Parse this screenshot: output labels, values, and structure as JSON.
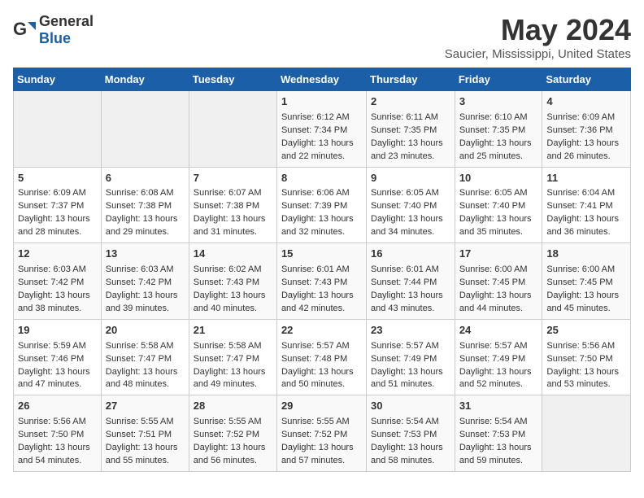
{
  "header": {
    "logo_general": "General",
    "logo_blue": "Blue",
    "title": "May 2024",
    "subtitle": "Saucier, Mississippi, United States"
  },
  "days_of_week": [
    "Sunday",
    "Monday",
    "Tuesday",
    "Wednesday",
    "Thursday",
    "Friday",
    "Saturday"
  ],
  "weeks": [
    [
      {
        "day": "",
        "content": ""
      },
      {
        "day": "",
        "content": ""
      },
      {
        "day": "",
        "content": ""
      },
      {
        "day": "1",
        "content": "Sunrise: 6:12 AM\nSunset: 7:34 PM\nDaylight: 13 hours and 22 minutes."
      },
      {
        "day": "2",
        "content": "Sunrise: 6:11 AM\nSunset: 7:35 PM\nDaylight: 13 hours and 23 minutes."
      },
      {
        "day": "3",
        "content": "Sunrise: 6:10 AM\nSunset: 7:35 PM\nDaylight: 13 hours and 25 minutes."
      },
      {
        "day": "4",
        "content": "Sunrise: 6:09 AM\nSunset: 7:36 PM\nDaylight: 13 hours and 26 minutes."
      }
    ],
    [
      {
        "day": "5",
        "content": "Sunrise: 6:09 AM\nSunset: 7:37 PM\nDaylight: 13 hours and 28 minutes."
      },
      {
        "day": "6",
        "content": "Sunrise: 6:08 AM\nSunset: 7:38 PM\nDaylight: 13 hours and 29 minutes."
      },
      {
        "day": "7",
        "content": "Sunrise: 6:07 AM\nSunset: 7:38 PM\nDaylight: 13 hours and 31 minutes."
      },
      {
        "day": "8",
        "content": "Sunrise: 6:06 AM\nSunset: 7:39 PM\nDaylight: 13 hours and 32 minutes."
      },
      {
        "day": "9",
        "content": "Sunrise: 6:05 AM\nSunset: 7:40 PM\nDaylight: 13 hours and 34 minutes."
      },
      {
        "day": "10",
        "content": "Sunrise: 6:05 AM\nSunset: 7:40 PM\nDaylight: 13 hours and 35 minutes."
      },
      {
        "day": "11",
        "content": "Sunrise: 6:04 AM\nSunset: 7:41 PM\nDaylight: 13 hours and 36 minutes."
      }
    ],
    [
      {
        "day": "12",
        "content": "Sunrise: 6:03 AM\nSunset: 7:42 PM\nDaylight: 13 hours and 38 minutes."
      },
      {
        "day": "13",
        "content": "Sunrise: 6:03 AM\nSunset: 7:42 PM\nDaylight: 13 hours and 39 minutes."
      },
      {
        "day": "14",
        "content": "Sunrise: 6:02 AM\nSunset: 7:43 PM\nDaylight: 13 hours and 40 minutes."
      },
      {
        "day": "15",
        "content": "Sunrise: 6:01 AM\nSunset: 7:43 PM\nDaylight: 13 hours and 42 minutes."
      },
      {
        "day": "16",
        "content": "Sunrise: 6:01 AM\nSunset: 7:44 PM\nDaylight: 13 hours and 43 minutes."
      },
      {
        "day": "17",
        "content": "Sunrise: 6:00 AM\nSunset: 7:45 PM\nDaylight: 13 hours and 44 minutes."
      },
      {
        "day": "18",
        "content": "Sunrise: 6:00 AM\nSunset: 7:45 PM\nDaylight: 13 hours and 45 minutes."
      }
    ],
    [
      {
        "day": "19",
        "content": "Sunrise: 5:59 AM\nSunset: 7:46 PM\nDaylight: 13 hours and 47 minutes."
      },
      {
        "day": "20",
        "content": "Sunrise: 5:58 AM\nSunset: 7:47 PM\nDaylight: 13 hours and 48 minutes."
      },
      {
        "day": "21",
        "content": "Sunrise: 5:58 AM\nSunset: 7:47 PM\nDaylight: 13 hours and 49 minutes."
      },
      {
        "day": "22",
        "content": "Sunrise: 5:57 AM\nSunset: 7:48 PM\nDaylight: 13 hours and 50 minutes."
      },
      {
        "day": "23",
        "content": "Sunrise: 5:57 AM\nSunset: 7:49 PM\nDaylight: 13 hours and 51 minutes."
      },
      {
        "day": "24",
        "content": "Sunrise: 5:57 AM\nSunset: 7:49 PM\nDaylight: 13 hours and 52 minutes."
      },
      {
        "day": "25",
        "content": "Sunrise: 5:56 AM\nSunset: 7:50 PM\nDaylight: 13 hours and 53 minutes."
      }
    ],
    [
      {
        "day": "26",
        "content": "Sunrise: 5:56 AM\nSunset: 7:50 PM\nDaylight: 13 hours and 54 minutes."
      },
      {
        "day": "27",
        "content": "Sunrise: 5:55 AM\nSunset: 7:51 PM\nDaylight: 13 hours and 55 minutes."
      },
      {
        "day": "28",
        "content": "Sunrise: 5:55 AM\nSunset: 7:52 PM\nDaylight: 13 hours and 56 minutes."
      },
      {
        "day": "29",
        "content": "Sunrise: 5:55 AM\nSunset: 7:52 PM\nDaylight: 13 hours and 57 minutes."
      },
      {
        "day": "30",
        "content": "Sunrise: 5:54 AM\nSunset: 7:53 PM\nDaylight: 13 hours and 58 minutes."
      },
      {
        "day": "31",
        "content": "Sunrise: 5:54 AM\nSunset: 7:53 PM\nDaylight: 13 hours and 59 minutes."
      },
      {
        "day": "",
        "content": ""
      }
    ]
  ]
}
